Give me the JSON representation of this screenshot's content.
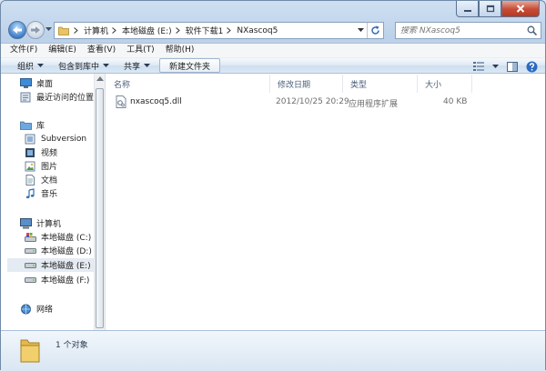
{
  "window": {
    "controls": [
      "minimize",
      "maximize",
      "close"
    ]
  },
  "address": {
    "crumbs": [
      "计算机",
      "本地磁盘 (E:)",
      "软件下载1",
      "NXascoq5"
    ]
  },
  "search": {
    "placeholder": "搜索 NXascoq5"
  },
  "menu": [
    "文件(F)",
    "编辑(E)",
    "查看(V)",
    "工具(T)",
    "帮助(H)"
  ],
  "commands": {
    "organize": "组织",
    "include_in_library": "包含到库中",
    "share": "共享",
    "new_folder": "新建文件夹"
  },
  "sidebar": {
    "favorites": [
      {
        "label": "桌面",
        "icon": "desktop-icon"
      },
      {
        "label": "最近访问的位置",
        "icon": "recent-places-icon"
      }
    ],
    "libraries": {
      "label": "库",
      "items": [
        {
          "label": "Subversion",
          "icon": "library-icon"
        },
        {
          "label": "视频",
          "icon": "video-icon"
        },
        {
          "label": "图片",
          "icon": "picture-icon"
        },
        {
          "label": "文档",
          "icon": "document-icon"
        },
        {
          "label": "音乐",
          "icon": "music-icon"
        }
      ]
    },
    "computer": {
      "label": "计算机",
      "items": [
        {
          "label": "本地磁盘 (C:)",
          "icon": "system-drive-icon"
        },
        {
          "label": "本地磁盘 (D:)",
          "icon": "drive-icon"
        },
        {
          "label": "本地磁盘 (E:)",
          "icon": "drive-icon",
          "selected": true
        },
        {
          "label": "本地磁盘 (F:)",
          "icon": "drive-icon"
        }
      ]
    },
    "network": {
      "label": "网络",
      "icon": "network-icon"
    }
  },
  "columns": {
    "name": "名称",
    "modified": "修改日期",
    "type": "类型",
    "size": "大小"
  },
  "files": [
    {
      "name": "nxascoq5.dll",
      "modified": "2012/10/25 20:29",
      "type": "应用程序扩展",
      "size": "40 KB",
      "icon": "dll-file-icon"
    }
  ],
  "details": {
    "count": "1 个对象"
  }
}
